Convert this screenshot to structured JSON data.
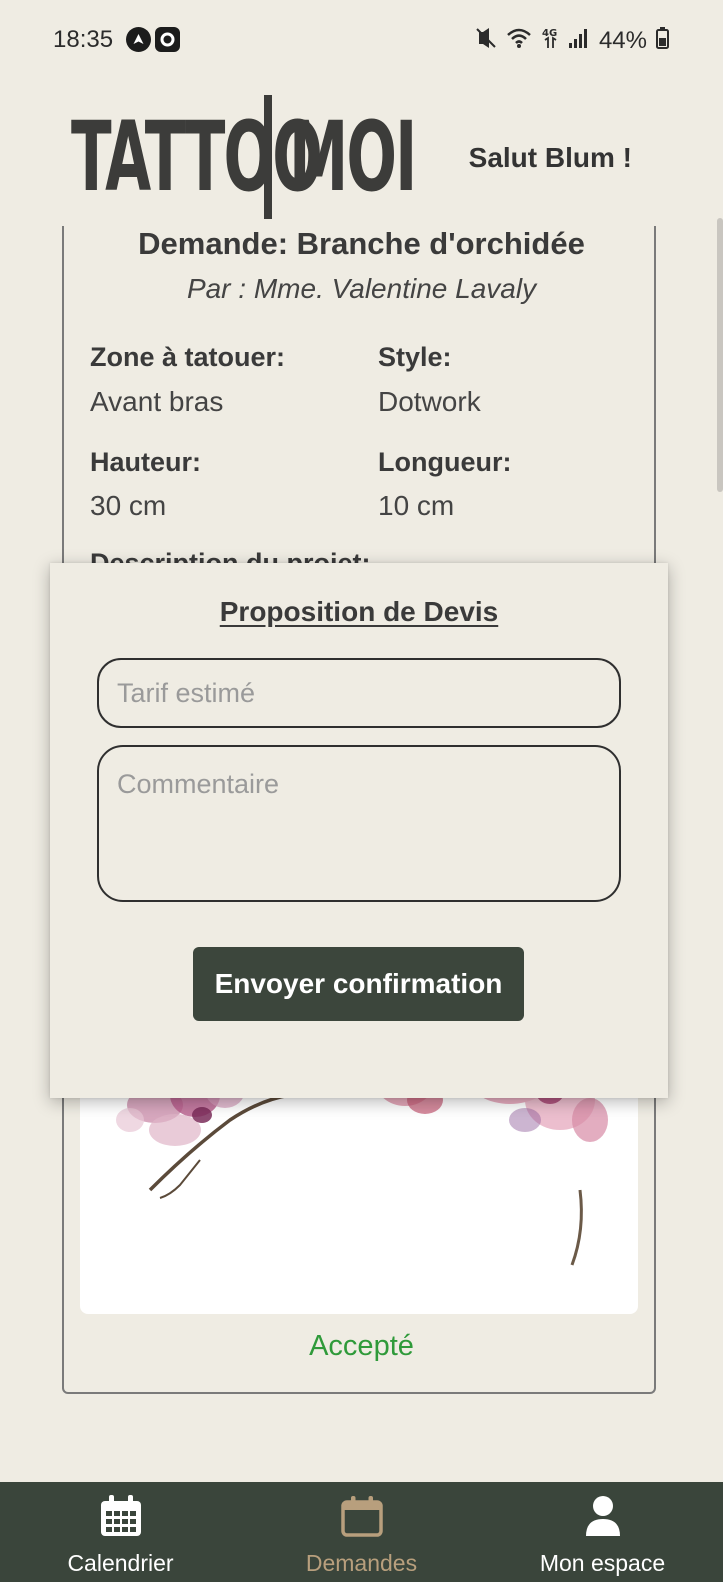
{
  "status_bar": {
    "time": "18:35",
    "battery": "44%"
  },
  "header": {
    "logo_left": "TATTOO",
    "logo_right": "MOI",
    "greeting": "Salut Blum !"
  },
  "request": {
    "title": "Demande: Branche d'orchidée",
    "author": "Par : Mme. Valentine Lavaly",
    "fields": [
      {
        "label": "Zone à tatouer:",
        "value": "Avant bras"
      },
      {
        "label": "Style:",
        "value": "Dotwork"
      },
      {
        "label": "Hauteur:",
        "value": "30 cm"
      },
      {
        "label": "Longueur:",
        "value": "10 cm"
      }
    ],
    "description_label": "Description du projet:",
    "status": "Accepté",
    "status_color": "#2f9a3a"
  },
  "modal": {
    "title": "Proposition de Devis",
    "tarif_placeholder": "Tarif estimé",
    "comment_placeholder": "Commentaire",
    "send_label": "Envoyer confirmation"
  },
  "nav": {
    "items": [
      {
        "label": "Calendrier",
        "icon": "calendar-grid-icon",
        "active": false
      },
      {
        "label": "Demandes",
        "icon": "calendar-icon",
        "active": true
      },
      {
        "label": "Mon espace",
        "icon": "user-icon",
        "active": false
      }
    ]
  },
  "colors": {
    "background": "#efece3",
    "nav_bg": "#3a453b",
    "button_bg": "#3c463c",
    "nav_active": "#b89f7d",
    "accepted": "#2f9a3a"
  }
}
